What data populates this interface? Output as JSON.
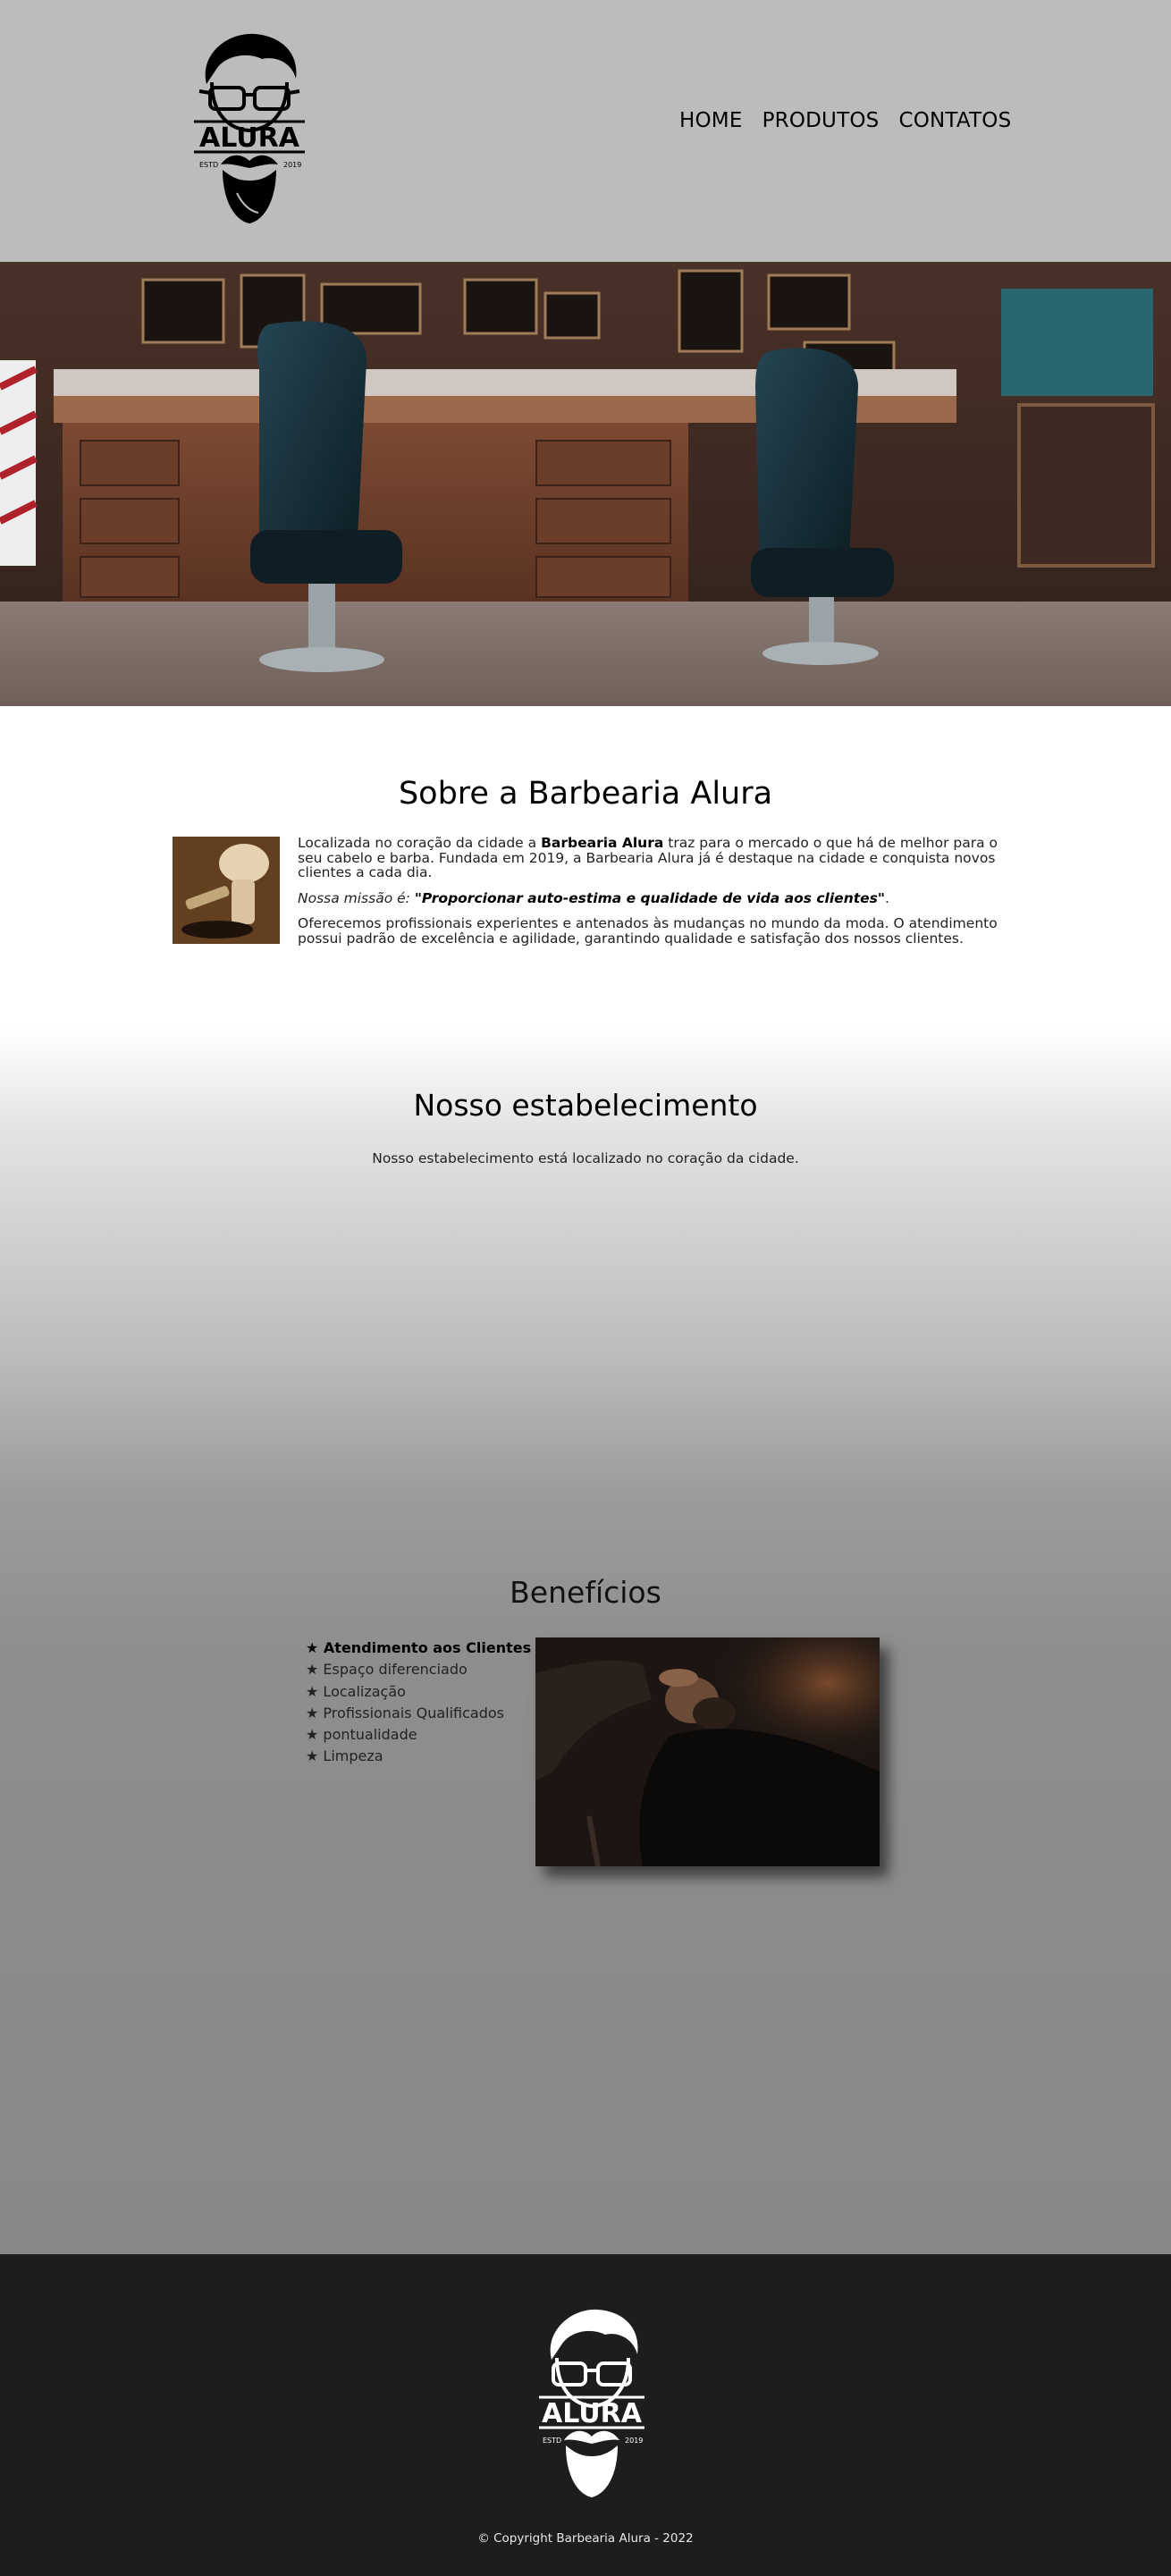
{
  "header": {
    "logo": {
      "icon": "bearded-man-logo",
      "brand": "ALURA",
      "left_text": "ESTD",
      "right_text": "2019"
    },
    "nav": [
      {
        "label": "HOME"
      },
      {
        "label": "PRODUTOS"
      },
      {
        "label": "CONTATOS"
      }
    ]
  },
  "hero": {
    "image": "barbershop-interior-photo"
  },
  "about": {
    "title": "Sobre a Barbearia Alura",
    "image": "shaving-brush-photo",
    "p1_before": "Localizada no coração da cidade a ",
    "p1_bold": "Barbearia Alura",
    "p1_after": " traz para o mercado o que há de melhor para o seu cabelo e barba. Fundada em 2019, a Barbearia Alura já é destaque na cidade e conquista novos clientes a cada dia.",
    "mission_label": "Nossa missão é: ",
    "mission_text": "\"Proporcionar auto-estima e qualidade de vida aos clientes\"",
    "mission_end": ".",
    "p3": "Oferecemos profissionais experientes e antenados às mudanças no mundo da moda. O atendimento possui padrão de excelência e agilidade, garantindo qualidade e satisfação dos nossos clientes."
  },
  "establishment": {
    "title": "Nosso estabelecimento",
    "text": "Nosso estabelecimento está localizado no coração da cidade."
  },
  "benefits": {
    "title": "Benefícios",
    "items": [
      "★ Atendimento aos Clientes",
      "★ Espaço diferenciado",
      "★ Localização",
      "★ Profissionais Qualificados",
      "★ pontualidade",
      "★ Limpeza"
    ],
    "image": "barber-shaving-client-photo"
  },
  "footer": {
    "logo": {
      "icon": "bearded-man-logo-white",
      "brand": "ALURA",
      "left_text": "ESTD",
      "right_text": "2019"
    },
    "copyright": "© Copyright Barbearia Alura - 2022"
  },
  "colors": {
    "header_bg": "#bcbcbc",
    "footer_bg": "#1d1d1d",
    "text": "#111111"
  }
}
